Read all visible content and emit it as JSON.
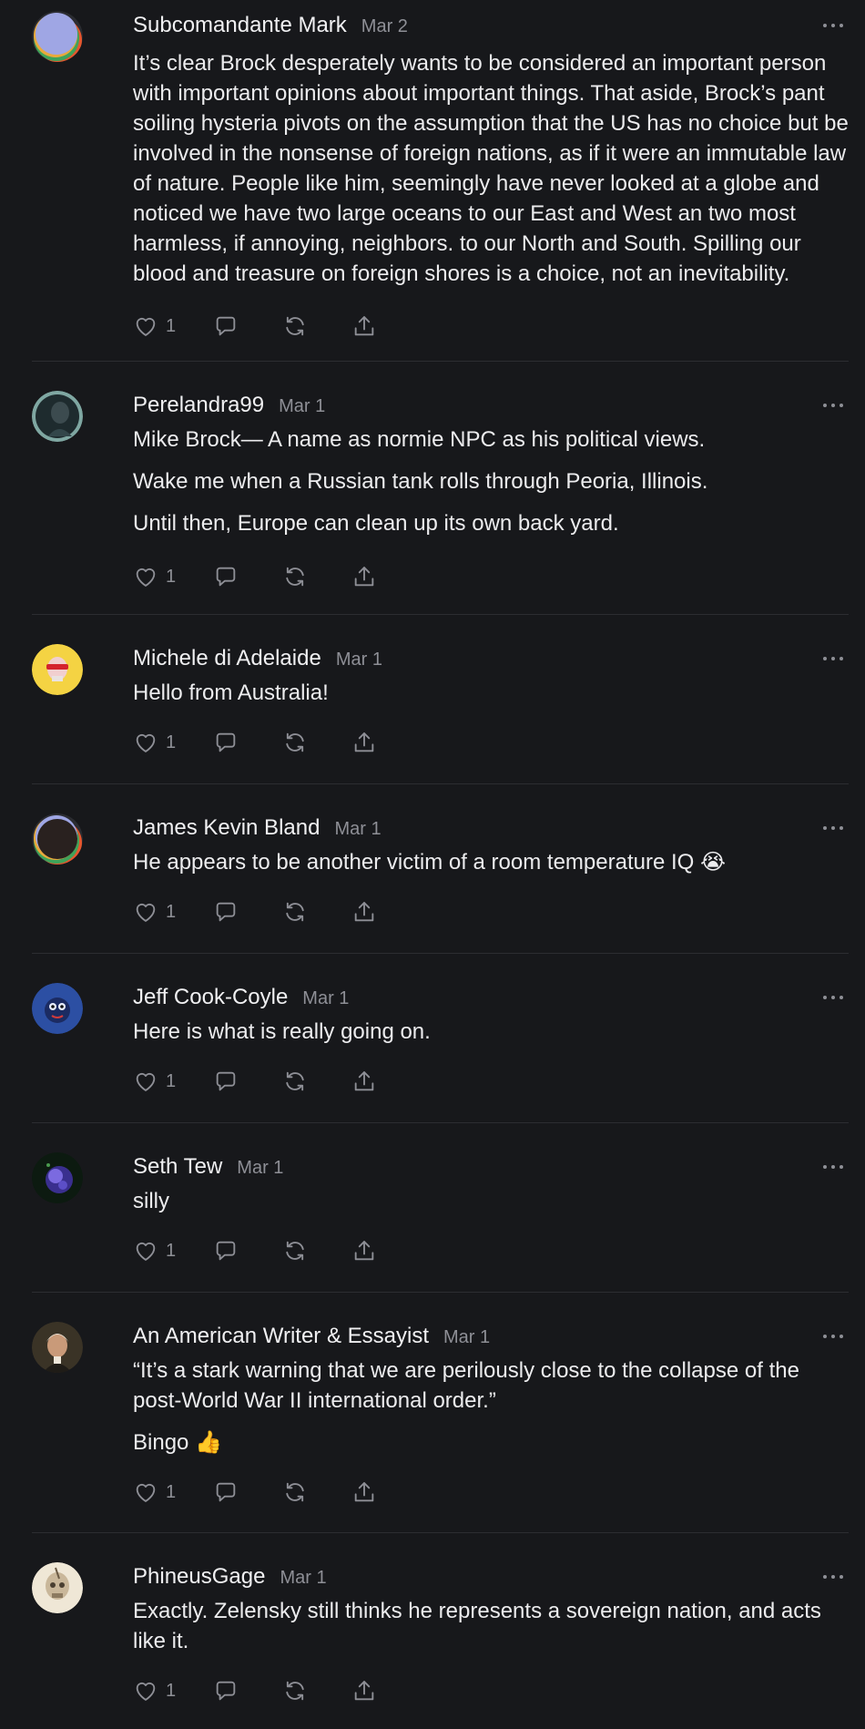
{
  "colors": {
    "background": "#17181b",
    "text": "#ececee",
    "muted": "#8e8f96",
    "divider": "#2c2d31"
  },
  "icons": {
    "like": "heart-icon",
    "reply": "comment-bubble-icon",
    "restack": "restack-arrows-icon",
    "share": "share-upload-icon",
    "more": "more-dots-icon"
  },
  "comments": [
    {
      "author": "Subcomandante Mark",
      "date": "Mar 2",
      "paragraphs": [
        "It’s clear Brock desperately wants to be considered an important person with important opinions about important things. That aside, Brock’s pant soiling hysteria pivots on the assumption that the US has no choice but be involved in the nonsense of foreign nations, as if it were an immutable law of nature. People like him, seemingly have never looked at a globe and noticed we have two large oceans to our East and West an two most harmless, if annoying, neighbors. to our North and South. Spilling our blood and treasure on foreign shores is a choice, not an inevitability."
      ],
      "likes": "1"
    },
    {
      "author": "Perelandra99",
      "date": "Mar 1",
      "paragraphs": [
        "Mike Brock— A name as normie NPC as his political views.",
        "Wake me when a Russian tank rolls through Peoria, Illinois.",
        "Until then, Europe can clean up its own back yard."
      ],
      "likes": "1"
    },
    {
      "author": "Michele di Adelaide",
      "date": "Mar 1",
      "paragraphs": [
        "Hello from Australia!"
      ],
      "likes": "1"
    },
    {
      "author": "James Kevin Bland",
      "date": "Mar 1",
      "paragraphs": [
        "He appears to be another victim of a room temperature IQ 😭"
      ],
      "likes": "1"
    },
    {
      "author": "Jeff Cook-Coyle",
      "date": "Mar 1",
      "paragraphs": [
        "Here is what is really going on."
      ],
      "likes": "1"
    },
    {
      "author": "Seth Tew",
      "date": "Mar 1",
      "paragraphs": [
        "silly"
      ],
      "likes": "1"
    },
    {
      "author": "An American Writer & Essayist",
      "date": "Mar 1",
      "paragraphs": [
        "“It’s a stark warning that we are perilously close to the collapse of the post-World War II international order.”",
        "Bingo 👍"
      ],
      "likes": "1"
    },
    {
      "author": "PhineusGage",
      "date": "Mar 1",
      "paragraphs": [
        "Exactly. Zelensky still thinks he represents a sovereign nation, and acts like it."
      ],
      "likes": "1"
    }
  ]
}
